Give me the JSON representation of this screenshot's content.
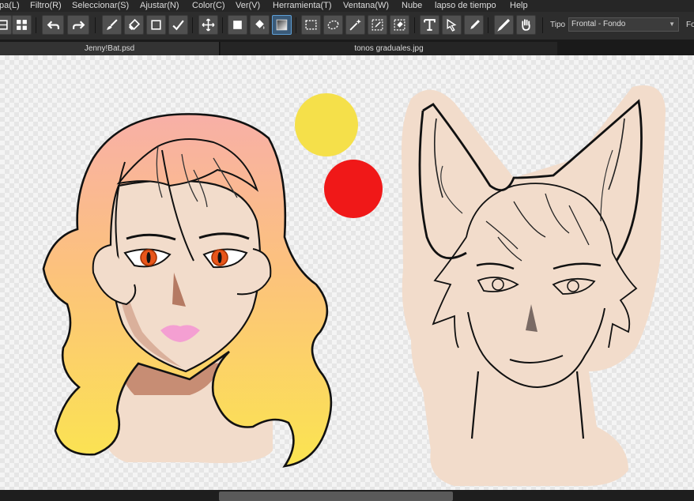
{
  "menu": [
    "pa(L)",
    "Filtro(R)",
    "Seleccionar(S)",
    "Ajustar(N)",
    "Color(C)",
    "Ver(V)",
    "Herramienta(T)",
    "Ventana(W)",
    "Nube",
    "lapso de tiempo",
    "Help"
  ],
  "toolbar": {
    "tipo_label": "Tipo",
    "tipo_value": "Frontal - Fondo",
    "fo_label": "Fo",
    "active_tool": "gradient-tool",
    "icons": [
      "layers-icon",
      "grid-icon",
      "undo-icon",
      "redo-icon",
      "brush-icon",
      "eraser-icon",
      "rectangle-icon",
      "check-icon",
      "move-icon",
      "fill-rect-icon",
      "bucket-icon",
      "gradient-icon",
      "select-rect-icon",
      "select-lasso-icon",
      "magic-wand-icon",
      "select-pen-icon",
      "select-eraser-icon",
      "text-icon",
      "select-cursor-icon",
      "blur-icon",
      "eyedropper-icon",
      "hand-icon"
    ]
  },
  "tabs": [
    {
      "label": "Jenny!Bat.psd",
      "active": true
    },
    {
      "label": "tonos graduales.jpg",
      "active": false
    }
  ],
  "colors": {
    "skin": "#f2dccb",
    "hair_top": "#f8b0a6",
    "hair_bottom": "#fbe352",
    "yellow_circle": "#f5e04a",
    "red_circle": "#f01818",
    "lips": "#f49fd2",
    "eyes": "#e8551a",
    "active_tool_bg": "#3a5a78",
    "active_tool_border": "#5d9fd6"
  }
}
